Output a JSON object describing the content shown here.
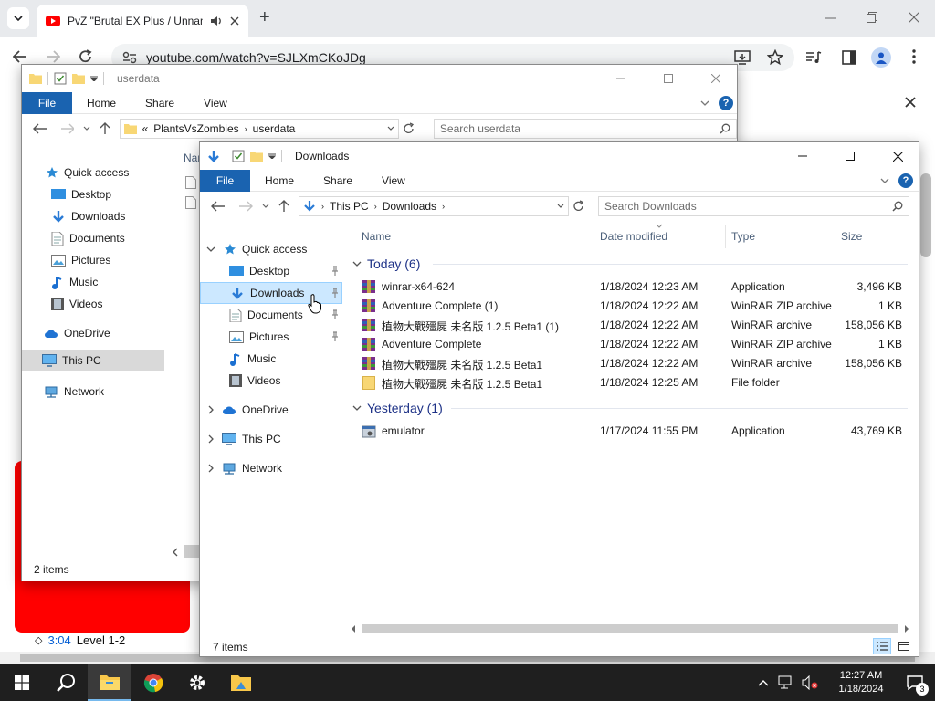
{
  "chrome": {
    "tab_title": "PvZ \"Brutal EX Plus / Unnamed",
    "url": "youtube.com/watch?v=SJLXmCKoJDg",
    "new_tab_symbol": "+",
    "accent": "#ff0000"
  },
  "youtube": {
    "chapter_time": "3:04",
    "chapter_title": "Level 1-2"
  },
  "back_window": {
    "title": "userdata",
    "ribbon_tabs": [
      "File",
      "Home",
      "Share",
      "View"
    ],
    "breadcrumb_prefix": "«",
    "breadcrumb": [
      "PlantsVsZombies",
      "userdata"
    ],
    "search_placeholder": "Search userdata",
    "column_name_partial": "Nar",
    "sidebar": [
      {
        "label": "Quick access",
        "icon": "star-icon"
      },
      {
        "label": "Desktop",
        "icon": "desktop-icon"
      },
      {
        "label": "Downloads",
        "icon": "download-arrow-icon"
      },
      {
        "label": "Documents",
        "icon": "document-icon"
      },
      {
        "label": "Pictures",
        "icon": "pictures-icon"
      },
      {
        "label": "Music",
        "icon": "music-note-icon"
      },
      {
        "label": "Videos",
        "icon": "film-icon"
      },
      {
        "label": "OneDrive",
        "icon": "cloud-icon"
      },
      {
        "label": "This PC",
        "icon": "monitor-icon"
      },
      {
        "label": "Network",
        "icon": "network-icon"
      }
    ],
    "status": "2 items"
  },
  "front_window": {
    "title": "Downloads",
    "ribbon_tabs": [
      "File",
      "Home",
      "Share",
      "View"
    ],
    "breadcrumb": [
      "This PC",
      "Downloads"
    ],
    "search_placeholder": "Search Downloads",
    "columns": [
      "Name",
      "Date modified",
      "Type",
      "Size"
    ],
    "sidebar": [
      {
        "label": "Quick access",
        "icon": "star-icon"
      },
      {
        "label": "Desktop",
        "icon": "desktop-icon"
      },
      {
        "label": "Downloads",
        "icon": "download-arrow-icon"
      },
      {
        "label": "Documents",
        "icon": "document-icon"
      },
      {
        "label": "Pictures",
        "icon": "pictures-icon"
      },
      {
        "label": "Music",
        "icon": "music-note-icon"
      },
      {
        "label": "Videos",
        "icon": "film-icon"
      },
      {
        "label": "OneDrive",
        "icon": "cloud-icon"
      },
      {
        "label": "This PC",
        "icon": "monitor-icon"
      },
      {
        "label": "Network",
        "icon": "network-icon"
      }
    ],
    "groups": [
      {
        "label": "Today (6)",
        "files": [
          {
            "name": "winrar-x64-624",
            "date": "1/18/2024 12:23 AM",
            "type": "Application",
            "size": "3,496 KB",
            "icon": "winrar-icon"
          },
          {
            "name": "Adventure Complete (1)",
            "date": "1/18/2024 12:22 AM",
            "type": "WinRAR ZIP archive",
            "size": "1 KB",
            "icon": "winrar-icon"
          },
          {
            "name": "植物大戰殭屍 未名版 1.2.5 Beta1 (1)",
            "date": "1/18/2024 12:22 AM",
            "type": "WinRAR archive",
            "size": "158,056 KB",
            "icon": "winrar-icon"
          },
          {
            "name": "Adventure Complete",
            "date": "1/18/2024 12:22 AM",
            "type": "WinRAR ZIP archive",
            "size": "1 KB",
            "icon": "winrar-icon"
          },
          {
            "name": "植物大戰殭屍 未名版 1.2.5 Beta1",
            "date": "1/18/2024 12:22 AM",
            "type": "WinRAR archive",
            "size": "158,056 KB",
            "icon": "winrar-icon"
          },
          {
            "name": "植物大戰殭屍 未名版 1.2.5 Beta1",
            "date": "1/18/2024 12:25 AM",
            "type": "File folder",
            "size": "",
            "icon": "folder-icon"
          }
        ]
      },
      {
        "label": "Yesterday (1)",
        "files": [
          {
            "name": "emulator",
            "date": "1/17/2024 11:55 PM",
            "type": "Application",
            "size": "43,769 KB",
            "icon": "app-icon"
          }
        ]
      }
    ],
    "status": "7 items"
  },
  "taskbar": {
    "time": "12:27 AM",
    "date": "1/18/2024",
    "notification_count": "3"
  },
  "colors": {
    "ribbon_file": "#1a63b0",
    "selection": "#cce8ff",
    "group_header": "#1e3287",
    "folder": "#f8d775"
  }
}
